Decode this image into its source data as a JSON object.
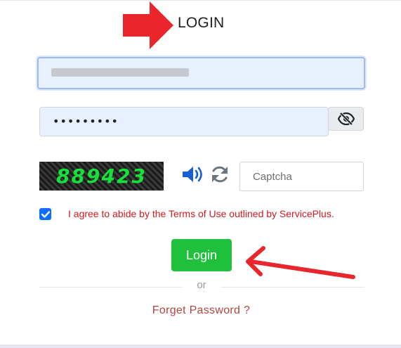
{
  "header": {
    "title": "LOGIN"
  },
  "form": {
    "username_value": "",
    "password_value": "•••••••••",
    "captcha": {
      "code": "889423",
      "placeholder": "Captcha",
      "audio_icon": "speaker-icon",
      "refresh_icon": "refresh-icon"
    },
    "password_toggle_icon": "eye-slash-icon",
    "agreement": {
      "checked": true,
      "text": "I agree to abide by the Terms of Use outlined by ServicePlus."
    },
    "submit_label": "Login",
    "separator": "or",
    "forgot_password": "Forget Password ?"
  },
  "annotations": {
    "arrow_color": "#e8262b"
  },
  "colors": {
    "primary_button": "#1fc13c",
    "checkbox": "#0d6efd",
    "terms_text": "#d4191f",
    "link": "#b3453f",
    "captcha_text": "#17e03a"
  }
}
